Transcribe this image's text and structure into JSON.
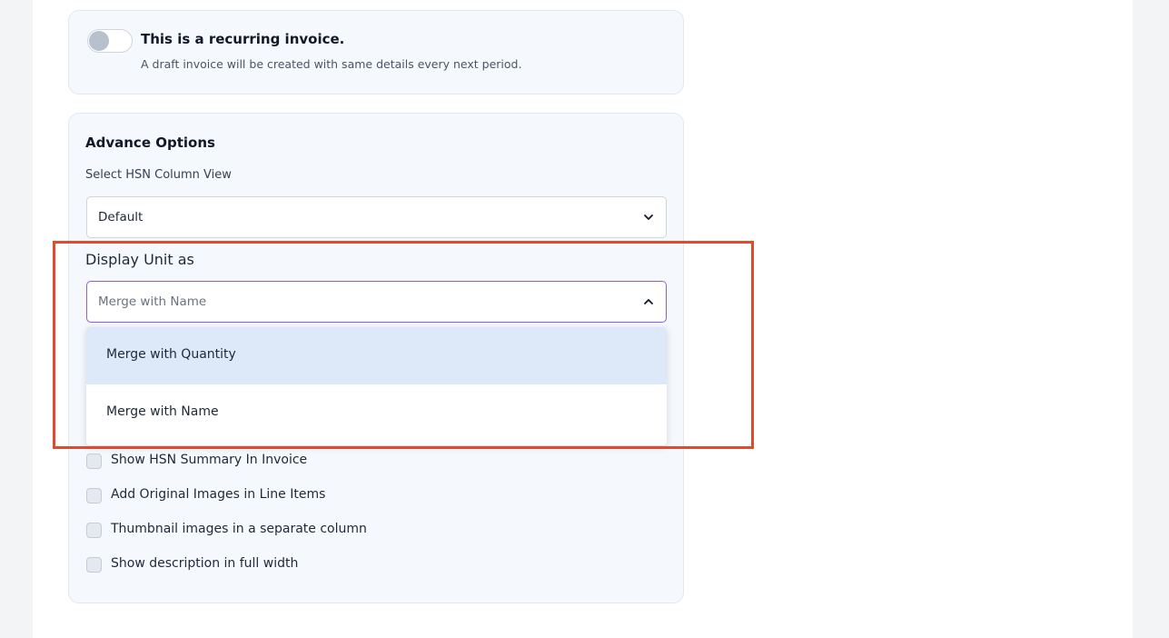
{
  "recurring": {
    "toggle_on": false,
    "title": "This is a recurring invoice.",
    "subtitle": "A draft invoice will be created with same details every next period."
  },
  "advance_options": {
    "title": "Advance Options",
    "hsn_column_view": {
      "label": "Select HSN Column View",
      "value": "Default",
      "icon": "chevron-down-icon"
    },
    "display_unit": {
      "label": "Display Unit as",
      "value": "Merge with Name",
      "icon": "chevron-up-icon",
      "open": true,
      "options": [
        "Merge with Quantity",
        "Merge with Name"
      ],
      "hovered_option": "Merge with Quantity"
    },
    "checkboxes": [
      {
        "label": "Show HSN Summary In Invoice",
        "checked": false
      },
      {
        "label": "Add Original Images in Line Items",
        "checked": false
      },
      {
        "label": "Thumbnail images in a separate column",
        "checked": false
      },
      {
        "label": "Show description in full width",
        "checked": false
      }
    ]
  },
  "colors": {
    "highlight": "#e24a2e",
    "select_focus": "#8b5cf6",
    "option_hover": "#dde8f8",
    "card_bg": "#f5f8fd"
  }
}
